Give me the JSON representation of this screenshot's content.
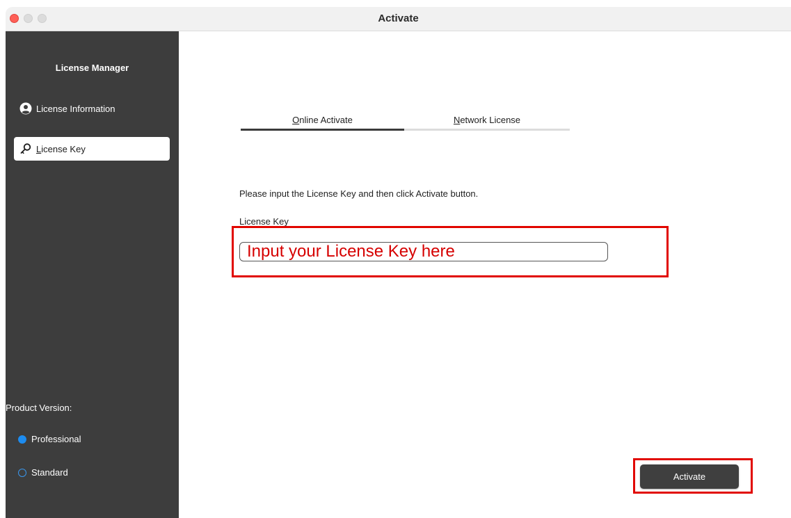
{
  "window": {
    "title": "Activate",
    "controls": [
      "close",
      "minimize",
      "maximize"
    ]
  },
  "sidebar": {
    "title": "License Manager",
    "items": [
      {
        "label": "License Information",
        "icon": "person-circle-icon",
        "selected": false
      },
      {
        "label_underlined": "L",
        "label_rest": "icense Key",
        "icon": "key-icon",
        "selected": true
      }
    ],
    "version_label": "Product Version:",
    "versions": [
      {
        "label": "Professional",
        "selected": true
      },
      {
        "label": "Standard",
        "selected": false
      }
    ]
  },
  "tabs": [
    {
      "underlined": "O",
      "rest": "nline Activate",
      "active": true
    },
    {
      "underlined": "N",
      "rest": "etwork License",
      "active": false
    }
  ],
  "main": {
    "instruction": "Please input the License Key and then click Activate button.",
    "license_key_label": "License Key",
    "license_key_placeholder": "Input your License Key here",
    "activate_label": "Activate"
  },
  "colors": {
    "sidebar_bg": "#3d3d3d",
    "highlight_box": "#e10600",
    "radio_selected": "#1d8cf0",
    "button_bg": "#3f3f3f"
  }
}
